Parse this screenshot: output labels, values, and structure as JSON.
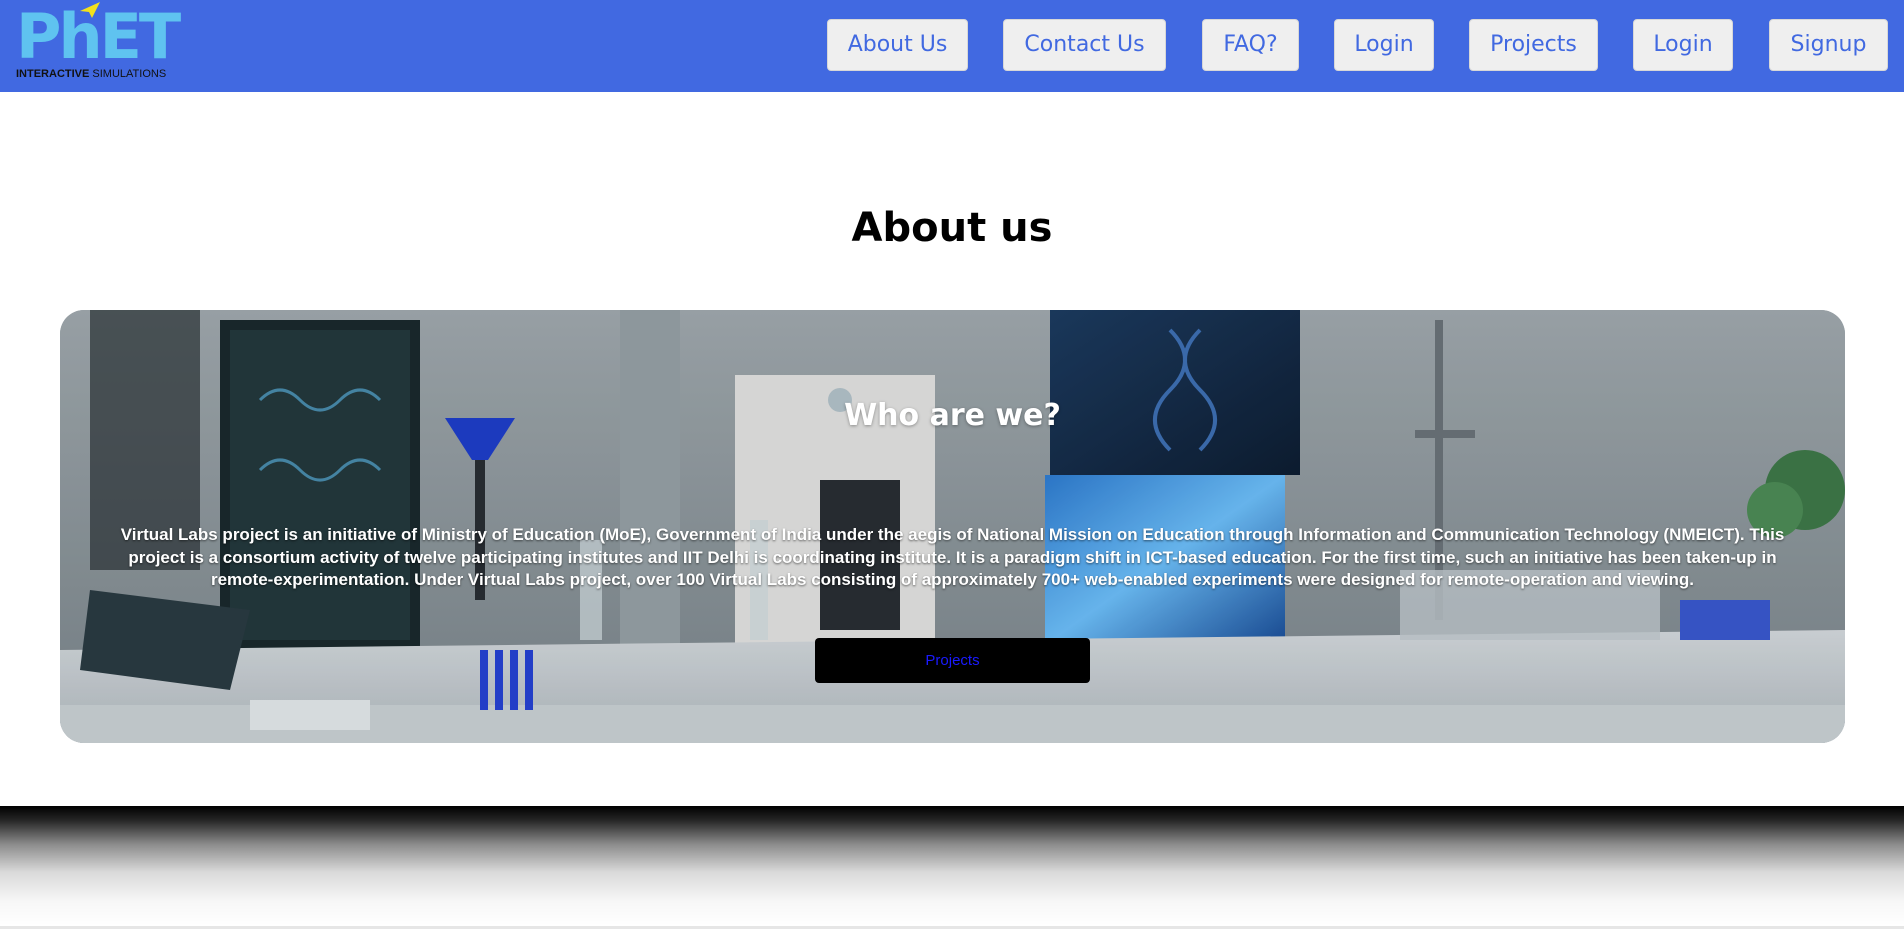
{
  "header": {
    "logo_main": "PhET",
    "logo_sub_bold": "INTERACTIVE",
    "logo_sub_rest": "SIMULATIONS",
    "nav": [
      {
        "label": "About Us"
      },
      {
        "label": "Contact Us"
      },
      {
        "label": "FAQ?"
      },
      {
        "label": "Login"
      },
      {
        "label": "Projects"
      },
      {
        "label": "Login"
      },
      {
        "label": "Signup"
      }
    ]
  },
  "main": {
    "title": "About us",
    "hero": {
      "heading": "Who are we?",
      "body": "Virtual Labs project is an initiative of Ministry of Education (MoE), Government of India under the aegis of National Mission on Education through Information and Communication Technology (NMEICT). This project is a consortium activity of twelve participating institutes and IIT Delhi is coordinating institute. It is a paradigm shift in ICT-based education. For the first time, such an initiative has been taken-up in remote-experimentation. Under Virtual Labs project, over 100 Virtual Labs consisting of approximately 700+ web-enabled experiments were designed for remote-operation and viewing.",
      "button_label": "Projects"
    }
  },
  "colors": {
    "header_bg": "#4169e1",
    "nav_text": "#4169e1",
    "nav_bg": "#efefef",
    "hero_button_bg": "#000000",
    "hero_button_text": "#1a1aff"
  }
}
